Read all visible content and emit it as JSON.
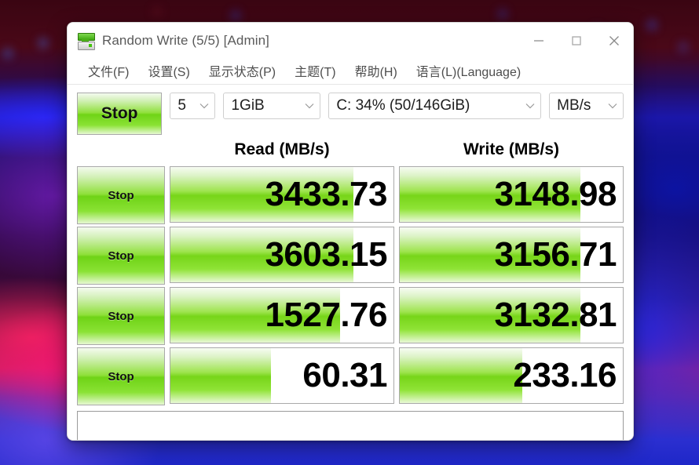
{
  "window": {
    "title": "Random Write (5/5) [Admin]",
    "icon": "disk-drive-icon",
    "minimize_label": "Minimize",
    "maximize_label": "Maximize",
    "close_label": "Close"
  },
  "menubar": {
    "items": [
      {
        "label": "文件(F)",
        "name": "menu-file"
      },
      {
        "label": "设置(S)",
        "name": "menu-settings"
      },
      {
        "label": "显示状态(P)",
        "name": "menu-display-state"
      },
      {
        "label": "主题(T)",
        "name": "menu-theme"
      },
      {
        "label": "帮助(H)",
        "name": "menu-help"
      },
      {
        "label": "语言(L)(Language)",
        "name": "menu-language"
      }
    ]
  },
  "toolbar": {
    "run_all_label": "Stop",
    "count": "5",
    "size": "1GiB",
    "drive": "C: 34% (50/146GiB)",
    "unit": "MB/s"
  },
  "headers": {
    "read": "Read (MB/s)",
    "write": "Write (MB/s)"
  },
  "rows": [
    {
      "button_label": "Stop",
      "read_value": "3433.73",
      "read_fill_percent": 82,
      "write_value": "3148.98",
      "write_fill_percent": 81
    },
    {
      "button_label": "Stop",
      "read_value": "3603.15",
      "read_fill_percent": 82,
      "write_value": "3156.71",
      "write_fill_percent": 81
    },
    {
      "button_label": "Stop",
      "read_value": "1527.76",
      "read_fill_percent": 76,
      "write_value": "3132.81",
      "write_fill_percent": 81
    },
    {
      "button_label": "Stop",
      "read_value": "60.31",
      "read_fill_percent": 45,
      "write_value": "233.16",
      "write_fill_percent": 55
    }
  ],
  "status": {
    "text": ""
  },
  "colors": {
    "green_bright": "#77d519",
    "green_light": "#dcf3c6",
    "title_text": "#5a5a5a",
    "value_text": "#000000"
  }
}
